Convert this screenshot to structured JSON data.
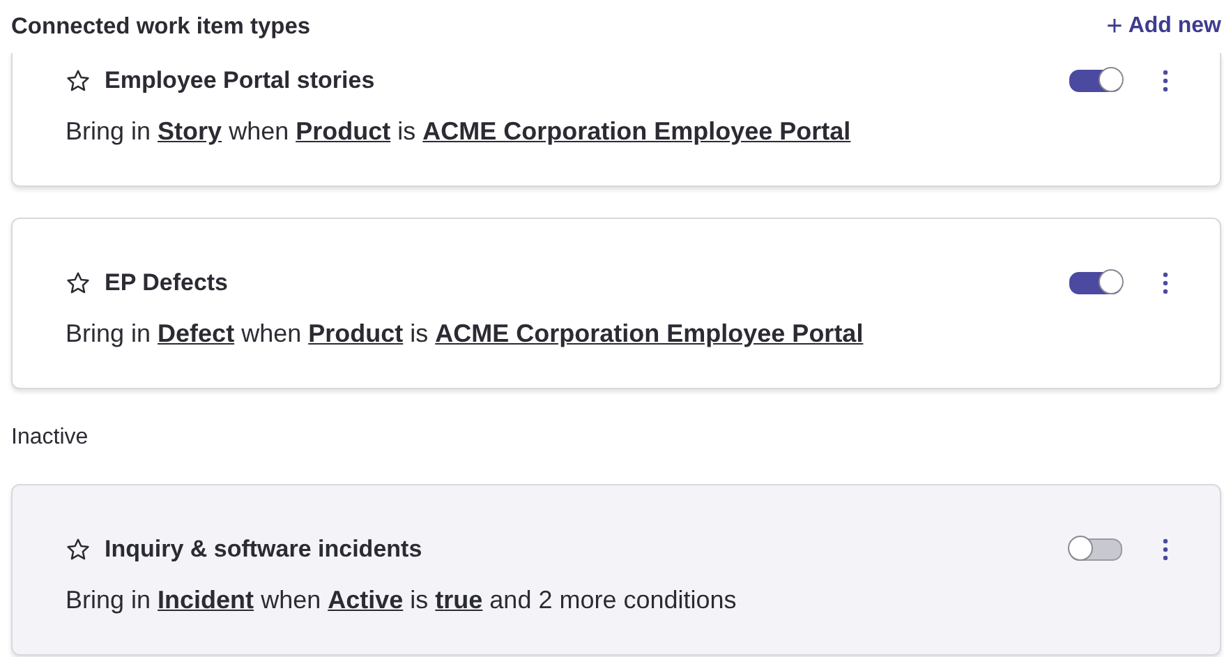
{
  "header": {
    "title": "Connected work item types",
    "add_button": {
      "icon": "+",
      "label": "Add new"
    }
  },
  "sections": [
    {
      "items": [
        {
          "title": "Employee Portal stories",
          "description": "Bring in **Story** when **Product** is **ACME Corporation Employee Portal**",
          "on": true
        },
        {
          "title": "EP Defects",
          "description": "Bring in **Defect** when **Product** is **ACME Corporation Employee Portal**",
          "on": true
        }
      ]
    },
    {
      "heading": "Inactive",
      "items": [
        {
          "title": "Inquiry & software incidents",
          "description": "Bring in **Incident** when **Active** is **true** and 2 more conditions",
          "on": false
        }
      ]
    }
  ]
}
